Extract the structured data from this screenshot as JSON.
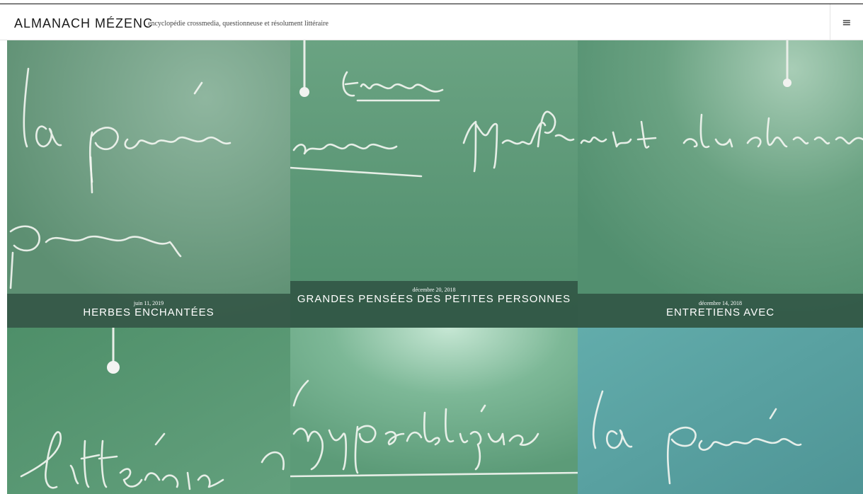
{
  "header": {
    "site_title": "ALMANACH MÉZENC",
    "tagline": "encyclopédie crossmedia, questionneuse et résolument littéraire",
    "menu_icon": "hamburger-menu-icon",
    "menu_glyph": "≡"
  },
  "posts": [
    {
      "date": "juin 11, 2019",
      "title": "HERBES ENCHANTÉES"
    },
    {
      "date": "décembre 20, 2018",
      "title": "GRANDES PENSÉES DES PETITES PERSONNES"
    },
    {
      "date": "décembre 14, 2018",
      "title": "ENTRETIENS AVEC"
    },
    {
      "date": "",
      "title": ""
    },
    {
      "date": "",
      "title": ""
    },
    {
      "date": "",
      "title": ""
    }
  ],
  "colors": {
    "board_green": "#5c9b78",
    "board_teal": "#5fa7a6",
    "caption_overlay": "#28463a"
  }
}
